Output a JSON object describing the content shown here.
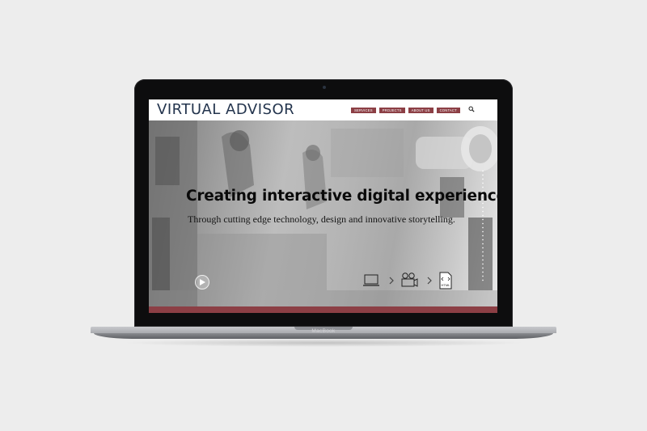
{
  "site": {
    "logo": "VIRTUAL ADVISOR",
    "nav": [
      "SERVICES",
      "PROJECTS",
      "ABOUT US",
      "CONTACT"
    ],
    "search_icon": "search-icon"
  },
  "hero": {
    "title": "Creating interactive digital experiences",
    "subtitle": "Through cutting edge technology, design and innovative storytelling.",
    "play_icon": "play-icon",
    "process_icons": [
      "laptop-icon",
      "film-camera-icon",
      "html-file-icon"
    ],
    "process_file_label": "HTML"
  },
  "device": {
    "brand": "MacBook"
  },
  "colors": {
    "accent": "#8c3f45",
    "logo": "#23344d",
    "device_bezel": "#0d0d0e",
    "background": "#ededed"
  }
}
